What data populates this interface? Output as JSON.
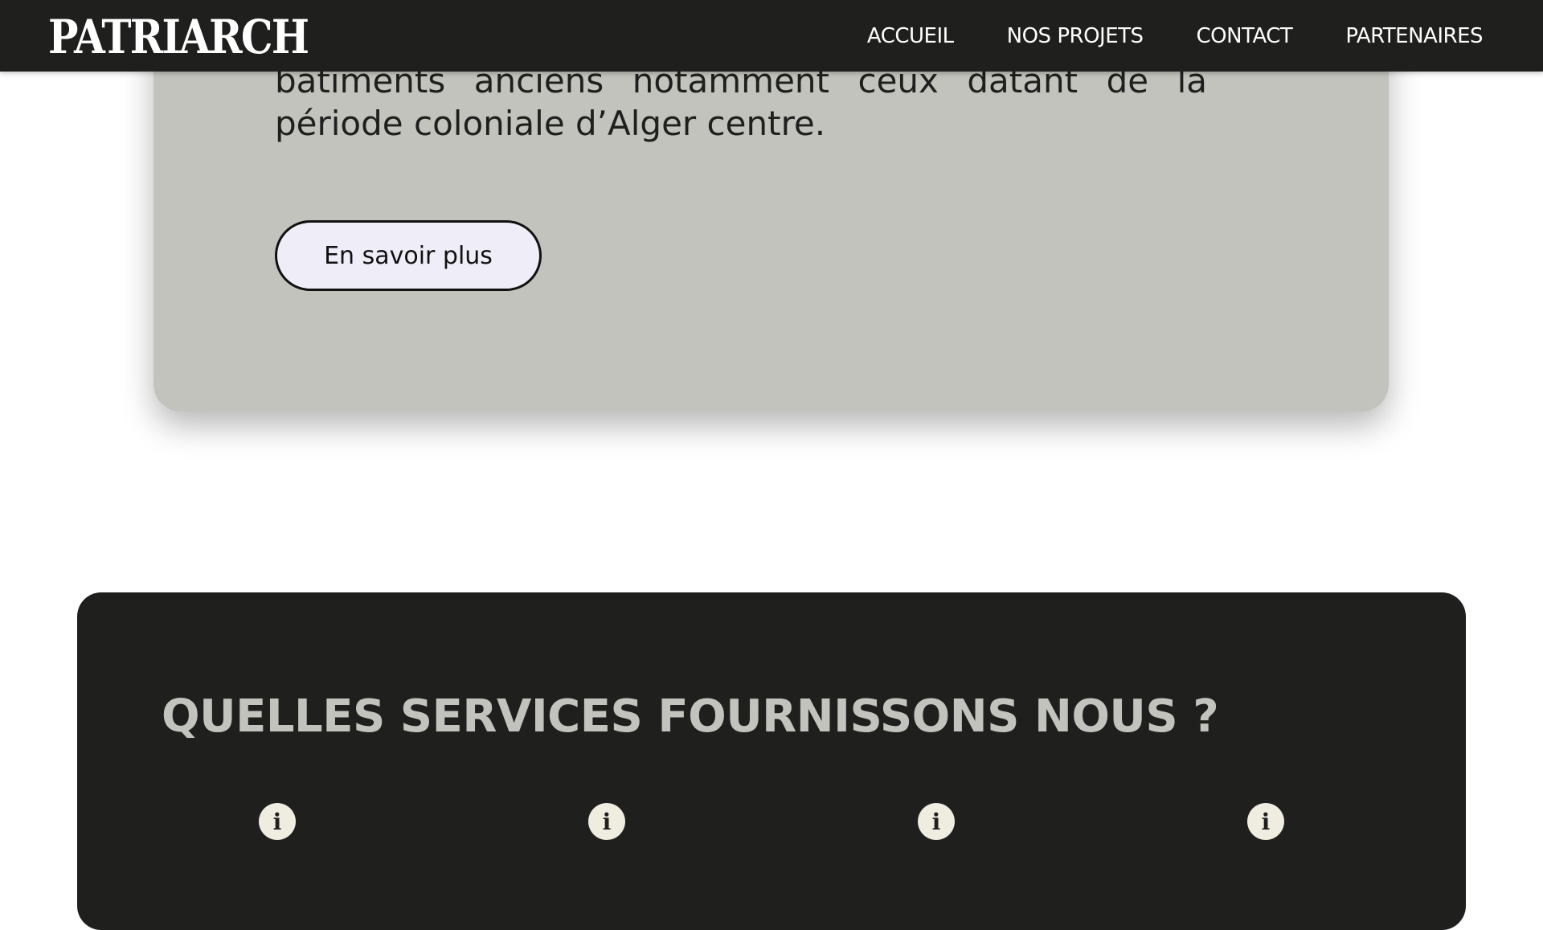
{
  "header": {
    "logo": "PATRIARCH",
    "nav": [
      {
        "label": "ACCUEIL"
      },
      {
        "label": "NOS PROJETS"
      },
      {
        "label": "CONTACT"
      },
      {
        "label": "PARTENAIRES"
      }
    ]
  },
  "hero": {
    "text": "bâtiments anciens notamment ceux datant de la période coloniale d’Alger centre.",
    "button_label": "En savoir plus"
  },
  "services": {
    "title": "QUELLES SERVICES FOURNISSONS NOUS ?",
    "items": [
      {
        "icon": "info-icon",
        "glyph": "i"
      },
      {
        "icon": "info-icon",
        "glyph": "i"
      },
      {
        "icon": "info-icon",
        "glyph": "i"
      },
      {
        "icon": "info-icon",
        "glyph": "i"
      }
    ]
  },
  "colors": {
    "header_bg": "#1f1f1e",
    "card_bg": "#c2c3bc",
    "button_bg": "#eeedf8",
    "services_bg": "#1f1f1e",
    "services_title": "#c2c3bc",
    "icon_bg": "#efece0"
  }
}
